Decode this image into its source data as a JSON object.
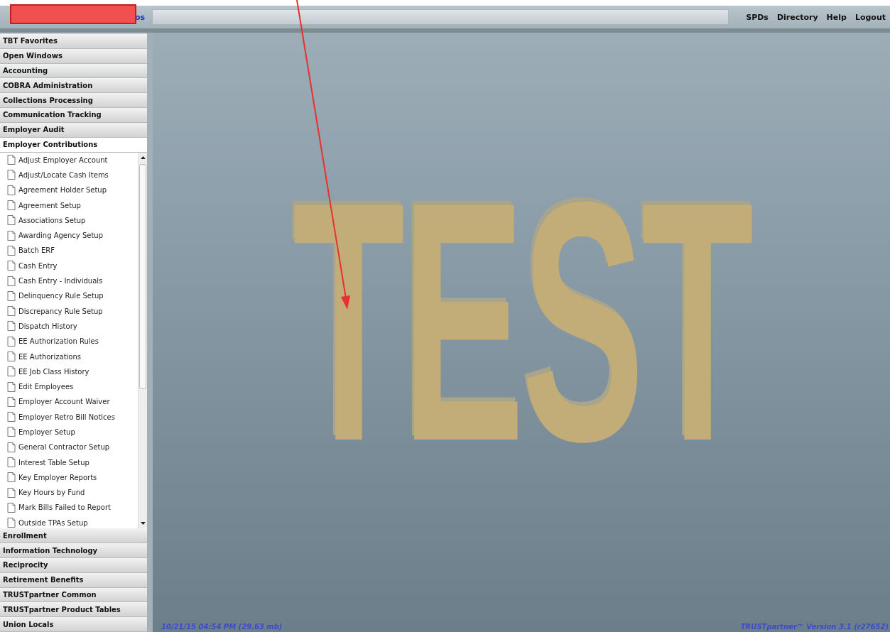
{
  "header": {
    "logo_text": "os",
    "links": [
      "SPDs",
      "Directory",
      "Help",
      "Logout"
    ]
  },
  "sidebar": {
    "sections": [
      {
        "label": "TBT Favorites",
        "expanded": false
      },
      {
        "label": "Open Windows",
        "expanded": false
      },
      {
        "label": "Accounting",
        "expanded": false
      },
      {
        "label": "COBRA Administration",
        "expanded": false
      },
      {
        "label": "Collections Processing",
        "expanded": false
      },
      {
        "label": "Communication Tracking",
        "expanded": false
      },
      {
        "label": "Employer Audit",
        "expanded": false
      },
      {
        "label": "Employer Contributions",
        "expanded": true,
        "items": [
          "Adjust Employer Account",
          "Adjust/Locate Cash Items",
          "Agreement Holder Setup",
          "Agreement Setup",
          "Associations Setup",
          "Awarding Agency Setup",
          "Batch ERF",
          "Cash Entry",
          "Cash Entry - Individuals",
          "Delinquency Rule Setup",
          "Discrepancy Rule Setup",
          "Dispatch History",
          "EE Authorization Rules",
          "EE Authorizations",
          "EE Job Class History",
          "Edit Employees",
          "Employer Account Waiver",
          "Employer Retro Bill Notices",
          "Employer Setup",
          "General Contractor Setup",
          "Interest Table Setup",
          "Key Employer Reports",
          "Key Hours by Fund",
          "Mark Bills Failed to Report",
          "Outside TPAs Setup"
        ]
      },
      {
        "label": "Enrollment",
        "expanded": false
      },
      {
        "label": "Information Technology",
        "expanded": false
      },
      {
        "label": "Reciprocity",
        "expanded": false
      },
      {
        "label": "Retirement Benefits",
        "expanded": false
      },
      {
        "label": "TRUSTpartner Common",
        "expanded": false
      },
      {
        "label": "TRUSTpartner Product Tables",
        "expanded": false
      },
      {
        "label": "Union Locals",
        "expanded": false
      }
    ]
  },
  "workspace": {
    "environment_mark": "TEST"
  },
  "status_bar": {
    "timestamp": "10/21/15 04:54 PM (29.63 mb)",
    "version": "TRUSTpartner™ Version  3.1 (r27652)"
  }
}
